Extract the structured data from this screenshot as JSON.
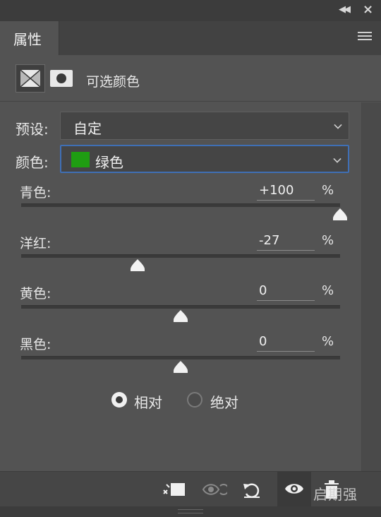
{
  "panel": {
    "tab_label": "属性",
    "adjustment_title": "可选颜色"
  },
  "preset": {
    "label": "预设:",
    "value": "自定"
  },
  "colors": {
    "label": "颜色:",
    "value": "绿色",
    "swatch_color": "#1f9d12"
  },
  "sliders": [
    {
      "label": "青色:",
      "value": "+100",
      "unit": "%",
      "level": 100
    },
    {
      "label": "洋红:",
      "value": "-27",
      "unit": "%",
      "level": -27
    },
    {
      "label": "黄色:",
      "value": "0",
      "unit": "%",
      "level": 0
    },
    {
      "label": "黑色:",
      "value": "0",
      "unit": "%",
      "level": 0
    }
  ],
  "method": {
    "options": [
      "相对",
      "绝对"
    ],
    "selected": "相对"
  },
  "bottom_icons": [
    "clip-to-layer-icon",
    "view-previous-state-icon",
    "reset-icon",
    "visibility-eye-icon",
    "delete-trash-icon"
  ],
  "watermark": "启期强"
}
